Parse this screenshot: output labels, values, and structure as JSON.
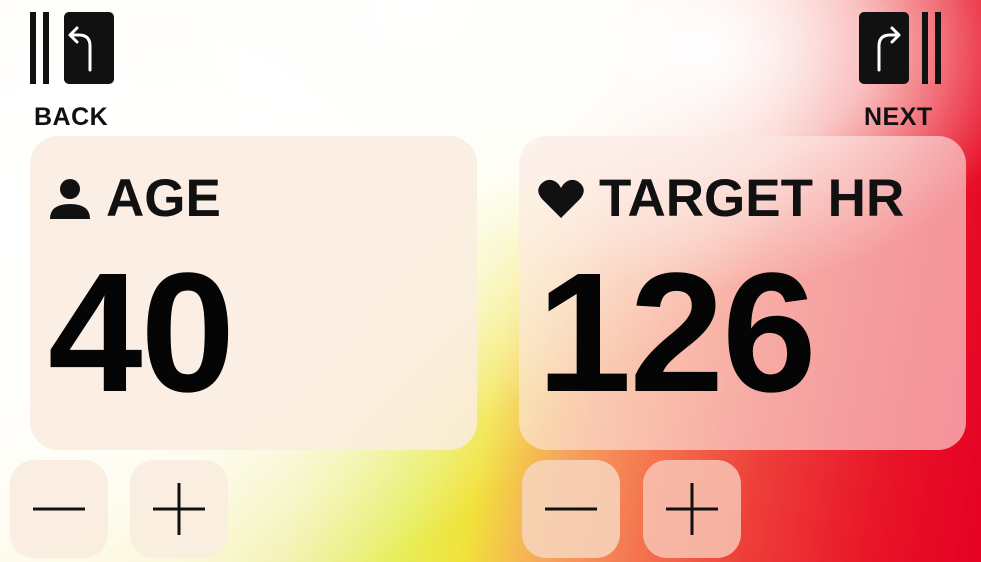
{
  "nav": {
    "back_label": "BACK",
    "next_label": "NEXT"
  },
  "age": {
    "label": "AGE",
    "value": "40",
    "icon": "person-icon"
  },
  "target_hr": {
    "label": "TARGET HR",
    "value": "126",
    "icon": "heart-icon"
  },
  "controls": {
    "decrement_icon": "minus-icon",
    "increment_icon": "plus-icon"
  },
  "colors": {
    "gradient_start": "#fffdf6",
    "gradient_yellow": "#e6ee5a",
    "gradient_orange": "#f4744f",
    "gradient_end_red": "#e60024",
    "text": "#111111"
  }
}
